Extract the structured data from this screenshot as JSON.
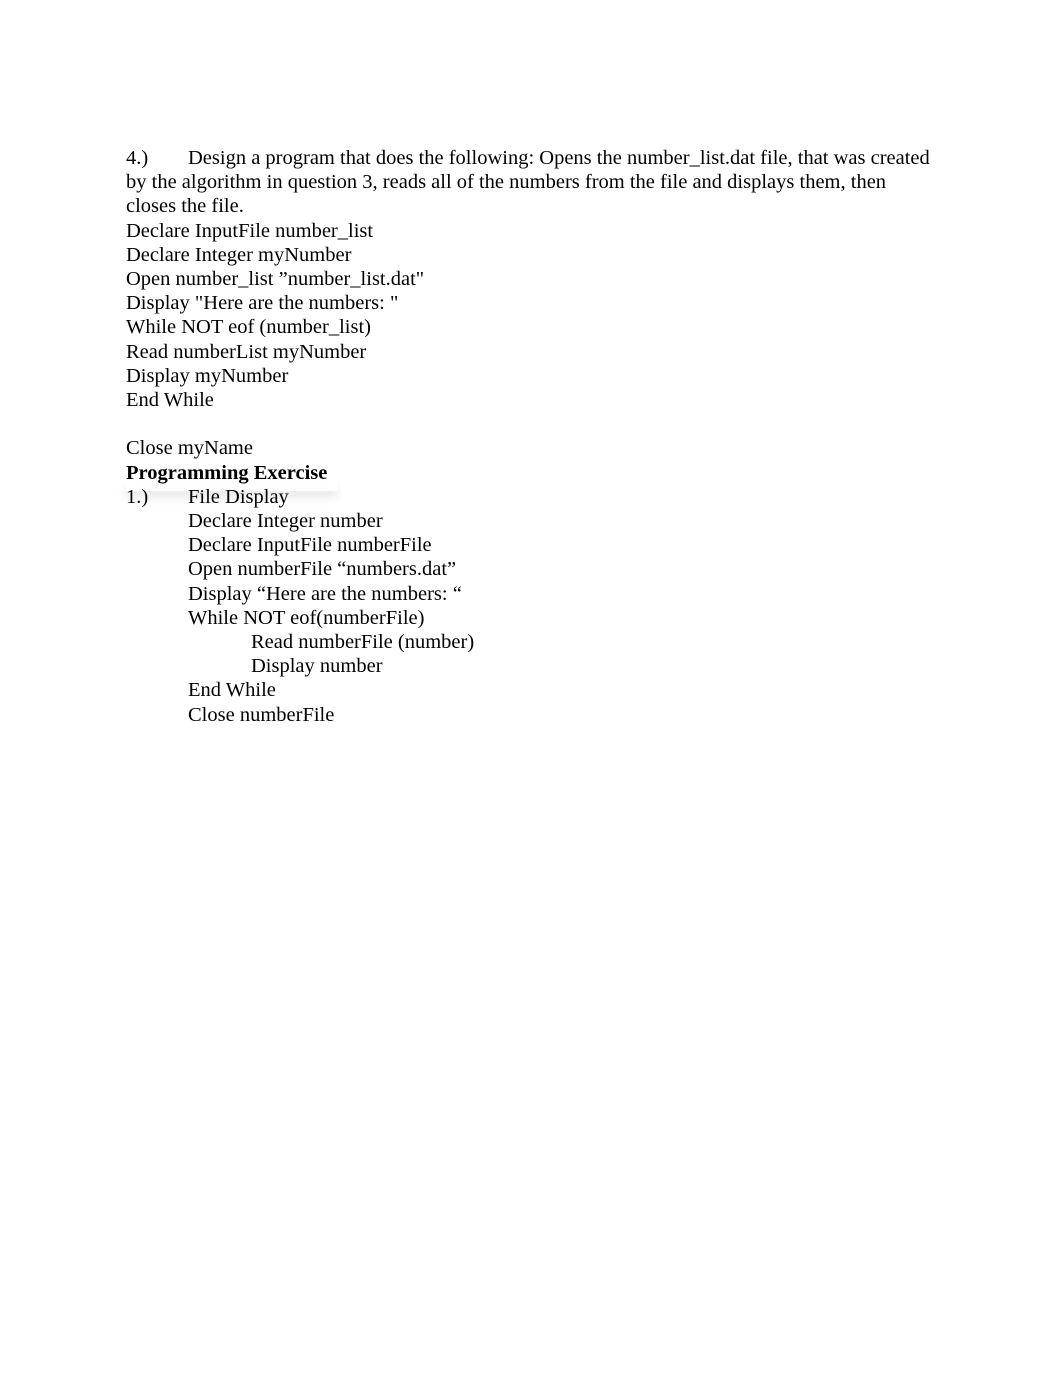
{
  "question4": {
    "number": "4.)",
    "prompt": "Design a program that does the following: Opens the number_list.dat file, that was created by the algorithm in question 3, reads all of the numbers from the file and displays them, then closes the file.",
    "code": [
      "Declare InputFile number_list",
      "Declare Integer myNumber",
      "Open number_list ”number_list.dat\"",
      "Display \"Here are the numbers: \"",
      "While NOT eof (number_list)",
      "Read numberList myNumber",
      "Display myNumber",
      "End While",
      "",
      "Close myName"
    ]
  },
  "programming_exercise": {
    "heading": "Programming Exercise",
    "number": "1.)",
    "title": "File Display",
    "code": [
      {
        "indent": 1,
        "text": "Declare Integer number"
      },
      {
        "indent": 1,
        "text": "Declare InputFile numberFile"
      },
      {
        "indent": 1,
        "text": "Open numberFile “numbers.dat”"
      },
      {
        "indent": 1,
        "text": "Display “Here are the numbers: “"
      },
      {
        "indent": 1,
        "text": "While NOT eof(numberFile)"
      },
      {
        "indent": 2,
        "text": "Read numberFile (number)"
      },
      {
        "indent": 2,
        "text": "Display number"
      },
      {
        "indent": 1,
        "text": "End While"
      },
      {
        "indent": 1,
        "text": "Close numberFile"
      }
    ]
  }
}
